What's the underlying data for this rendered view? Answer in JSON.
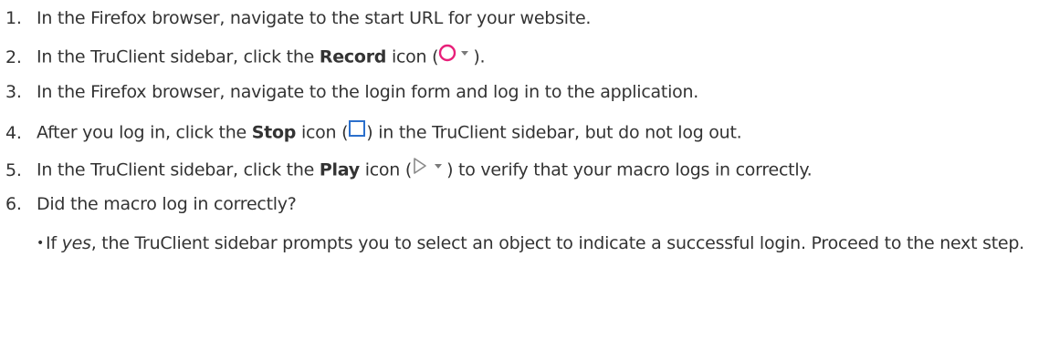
{
  "steps": [
    {
      "num": "1.",
      "text": "In the Firefox browser, navigate to the start URL for your website."
    },
    {
      "num": "2.",
      "pre": "In the TruClient sidebar, click the ",
      "bold": "Record",
      "mid": " icon (",
      "icon": "record-icon",
      "post": ")."
    },
    {
      "num": "3.",
      "text": "In the Firefox browser, navigate to the login form and log in to the application."
    },
    {
      "num": "4.",
      "pre": "After you log in, click the ",
      "bold": "Stop",
      "mid": " icon (",
      "icon": "stop-icon",
      "post": ") in the TruClient sidebar, but do not log out."
    },
    {
      "num": "5.",
      "pre": "In the TruClient sidebar, click the ",
      "bold": "Play",
      "mid": " icon (",
      "icon": "play-icon",
      "post": ") to verify that your macro logs in correctly."
    },
    {
      "num": "6.",
      "text": "Did the macro log in correctly?"
    }
  ],
  "sub_items": [
    {
      "bullet": "•",
      "pre": "If ",
      "em": "yes",
      "post": ", the TruClient sidebar prompts you to select an object to indicate a successful login. Proceed to the next step."
    }
  ],
  "colors": {
    "record_icon": "#e8207a",
    "dropdown_icon": "#7a7a7a",
    "stop_icon": "#2b6fcc",
    "play_icon": "#8a8a8a"
  }
}
